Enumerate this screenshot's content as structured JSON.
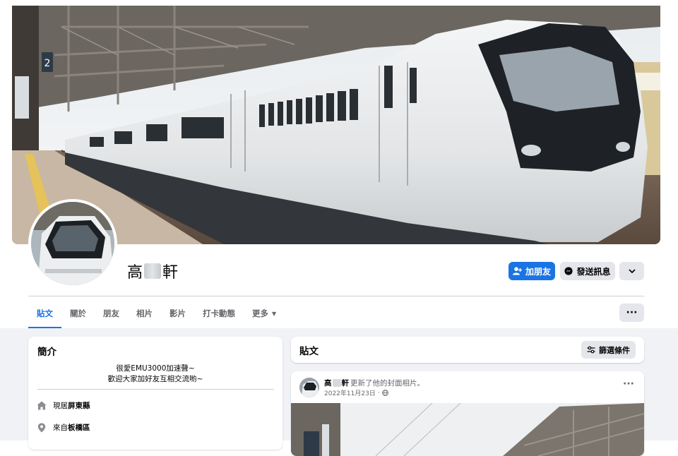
{
  "profile": {
    "name_first": "高",
    "name_last": "軒"
  },
  "actions": {
    "add_friend": "加朋友",
    "message": "發送訊息"
  },
  "tabs": [
    {
      "label": "貼文",
      "active": true
    },
    {
      "label": "關於"
    },
    {
      "label": "朋友"
    },
    {
      "label": "相片"
    },
    {
      "label": "影片"
    },
    {
      "label": "打卡動態"
    },
    {
      "label": "更多"
    }
  ],
  "intro": {
    "title": "簡介",
    "bio_line1": "很愛EMU3000加速聲~",
    "bio_line2": "歡迎大家加好友互相交流喲~",
    "lives_prefix": "現居",
    "lives_value": "屏東縣",
    "from_prefix": "來自",
    "from_value": "板橋區"
  },
  "posts_header": {
    "title": "貼文",
    "filter": "篩選條件"
  },
  "post": {
    "author_first": "高",
    "author_last": "軒",
    "action": "更新了他的封面相片。",
    "date": "2022年11月23日",
    "separator": "·"
  },
  "cover": {
    "platform_sign": "2"
  },
  "colors": {
    "accent": "#1b74e4",
    "secondary_bg": "#e4e6eb",
    "feed_bg": "#f0f2f5"
  },
  "icons": {
    "add_friend": "person-plus-icon",
    "message": "messenger-icon",
    "more": "chevron-down-icon",
    "filter": "sliders-icon",
    "home": "home-icon",
    "location": "pin-icon",
    "privacy": "globe-icon"
  }
}
